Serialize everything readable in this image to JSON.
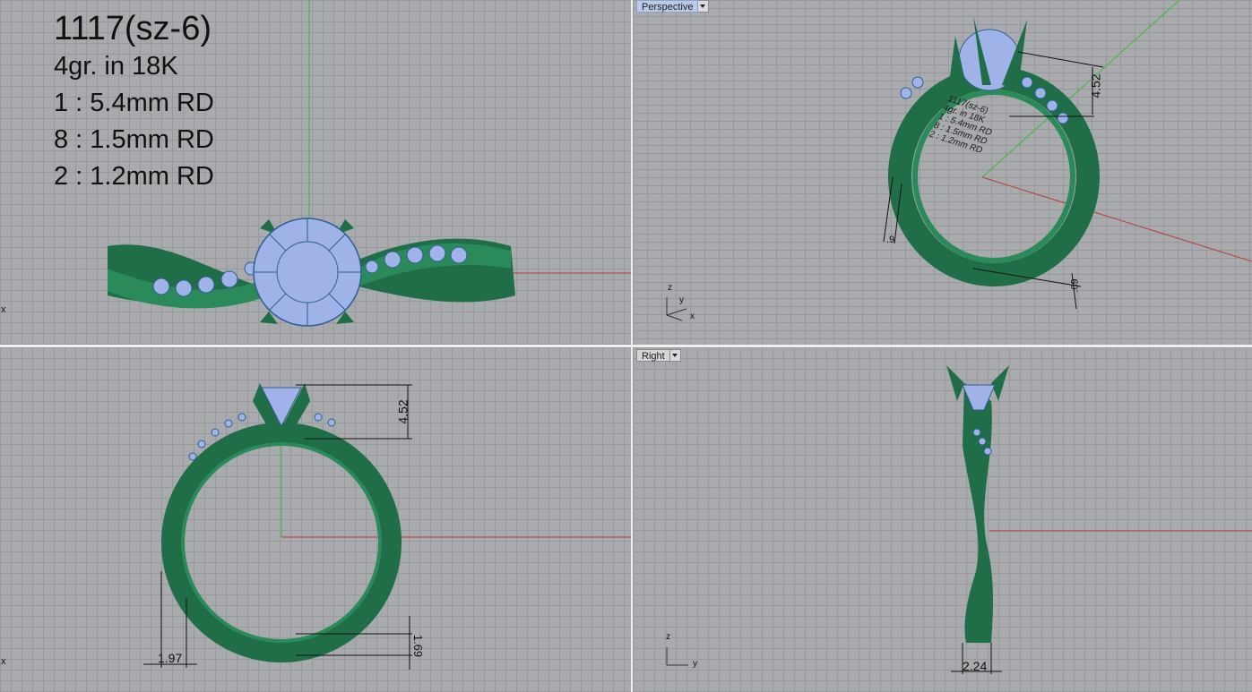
{
  "viewports": {
    "top": {
      "spec_lines": [
        "1117(sz-6)",
        "4gr.  in 18K",
        "1 : 5.4mm RD",
        "8 : 1.5mm RD",
        "2 : 1.2mm RD"
      ],
      "axis_label": "x"
    },
    "perspective": {
      "label": "Perspective",
      "dimensions": [
        "4.52",
        ".9",
        ".69"
      ],
      "engraved_text": [
        "1117(sz-6)",
        "4gr.  in 18K",
        "1 : 5.4mm RD",
        "8 : 1.5mm RD",
        "2 : 1.2mm RD"
      ],
      "axis_labels": [
        "z",
        "y",
        "x"
      ]
    },
    "front": {
      "dimensions": [
        "4.52",
        "1.97",
        "1.69"
      ],
      "axis_label": "x"
    },
    "right": {
      "label": "Right",
      "dimensions": [
        "2.24"
      ],
      "axis_labels": [
        "z",
        "y"
      ]
    }
  },
  "colors": {
    "ring_metal": "#1f6e47",
    "gem": "#9fb3e8",
    "x_axis": "#b83c3c",
    "y_axis": "#3cb83c"
  }
}
